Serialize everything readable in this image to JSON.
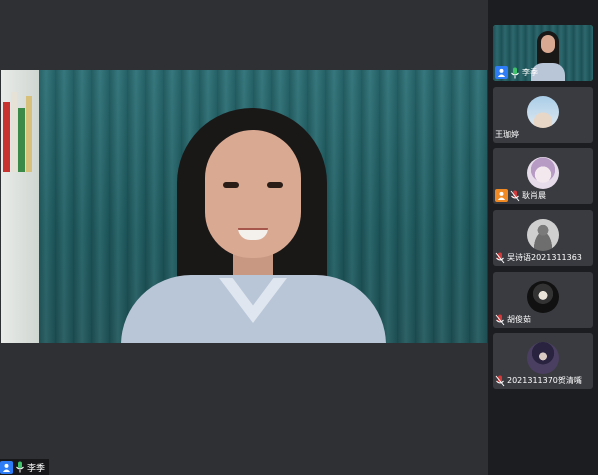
{
  "main": {
    "speaker_name": "李季"
  },
  "participants": [
    {
      "name": "李季",
      "mic": "on",
      "active": true,
      "avatar": "video"
    },
    {
      "name": "王珈婷",
      "mic": "none",
      "avatar": "avatar-girl-sky"
    },
    {
      "name": "耿肖晨",
      "mic": "muted",
      "avatar": "avatar-anime-purple"
    },
    {
      "name": "吴诗语2021311363",
      "mic": "muted",
      "avatar": "avatar-gray-figure"
    },
    {
      "name": "胡俊茹",
      "mic": "muted",
      "avatar": "avatar-dark-character"
    },
    {
      "name": "2021311370贺清嘴",
      "mic": "muted",
      "avatar": "avatar-dark-anime"
    }
  ],
  "colors": {
    "active_border": "#3fc26a",
    "user_icon_blue": "#2e7cf6",
    "user_icon_orange": "#f08a24",
    "mic_on": "#3fc26a"
  }
}
